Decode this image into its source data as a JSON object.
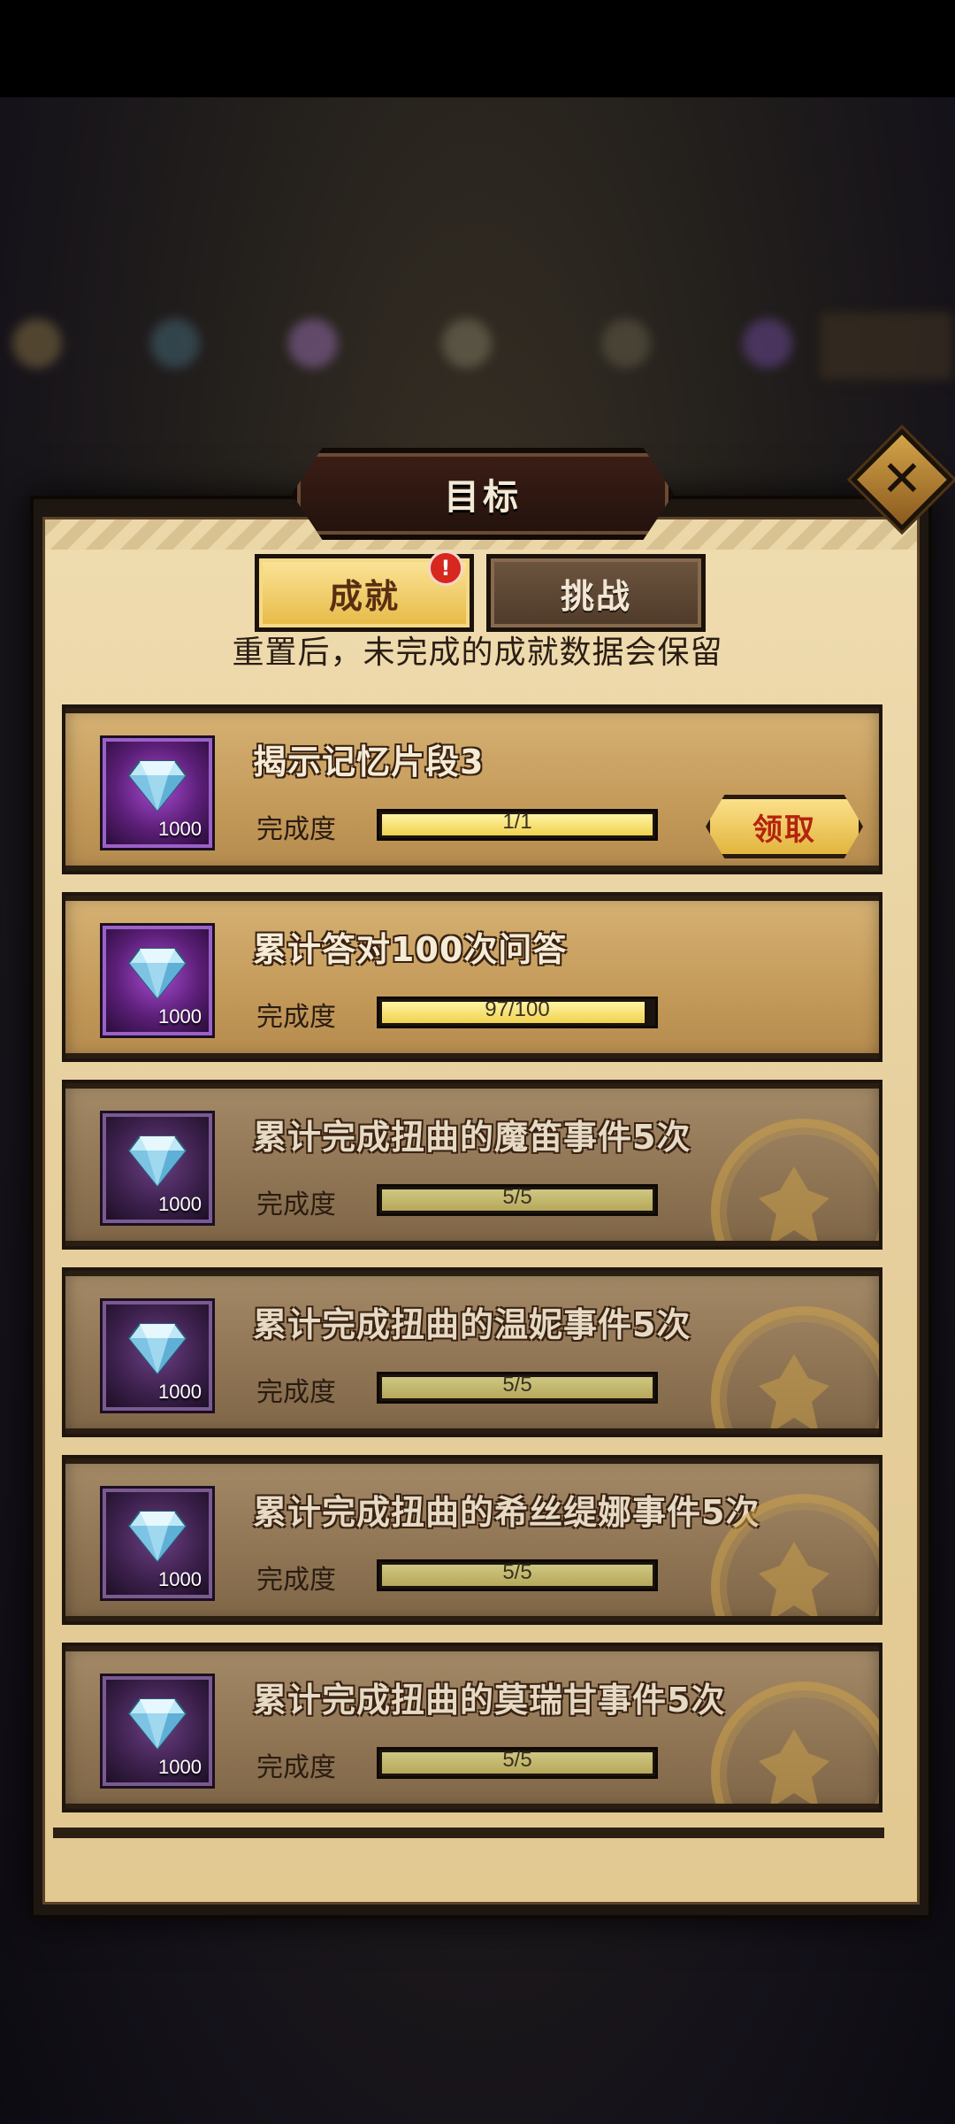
{
  "dialog": {
    "title": "目标",
    "close_label": "✕",
    "tabs": [
      {
        "label": "成就",
        "active": true,
        "badge": "!"
      },
      {
        "label": "挑战",
        "active": false
      }
    ],
    "note": "重置后，未完成的成就数据会保留"
  },
  "progress_label": "完成度",
  "claim_label": "领取",
  "colors": {
    "accent_gold": "#f0d24e",
    "claim_text": "#b4230f",
    "reward_purple": "#7a2fa3"
  },
  "achievements": [
    {
      "title": "揭示记忆片段3",
      "reward_icon": "diamond-icon",
      "reward_qty": "1000",
      "progress": "1/1",
      "fraction": 1.0,
      "state": "claimable"
    },
    {
      "title": "累计答对100次问答",
      "reward_icon": "diamond-icon",
      "reward_qty": "1000",
      "progress": "97/100",
      "fraction": 0.97,
      "state": "in-progress"
    },
    {
      "title": "累计完成扭曲的魔笛事件5次",
      "reward_icon": "diamond-icon",
      "reward_qty": "1000",
      "progress": "5/5",
      "fraction": 1.0,
      "state": "claimed"
    },
    {
      "title": "累计完成扭曲的温妮事件5次",
      "reward_icon": "diamond-icon",
      "reward_qty": "1000",
      "progress": "5/5",
      "fraction": 1.0,
      "state": "claimed"
    },
    {
      "title": "累计完成扭曲的希丝缇娜事件5次",
      "reward_icon": "diamond-icon",
      "reward_qty": "1000",
      "progress": "5/5",
      "fraction": 1.0,
      "state": "claimed"
    },
    {
      "title": "累计完成扭曲的莫瑞甘事件5次",
      "reward_icon": "diamond-icon",
      "reward_qty": "1000",
      "progress": "5/5",
      "fraction": 1.0,
      "state": "claimed"
    }
  ]
}
